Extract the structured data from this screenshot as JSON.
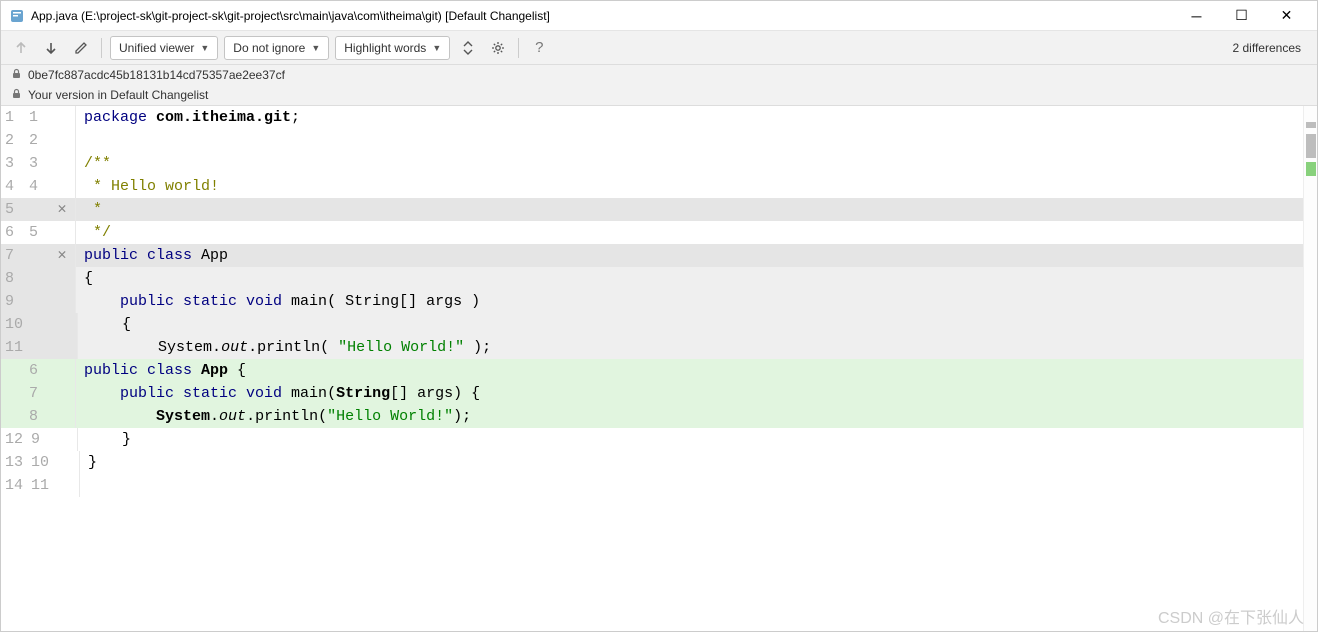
{
  "window": {
    "title": "App.java (E:\\project-sk\\git-project-sk\\git-project\\src\\main\\java\\com\\itheima\\git) [Default Changelist]"
  },
  "toolbar": {
    "viewer_label": "Unified viewer",
    "ignore_label": "Do not ignore",
    "highlight_label": "Highlight words",
    "diff_count": "2 differences"
  },
  "info": {
    "commit_hash": "0be7fc887acdc45b18131b14cd75357ae2ee37cf",
    "version_label": "Your version in Default Changelist"
  },
  "code": {
    "lines": [
      {
        "l": "1",
        "r": "1",
        "cls": "",
        "tokens": [
          {
            "t": "kw",
            "v": "package "
          },
          {
            "t": "pkg",
            "v": "com.itheima.git"
          },
          {
            "t": "",
            "v": ";"
          }
        ]
      },
      {
        "l": "2",
        "r": "2",
        "cls": "",
        "tokens": []
      },
      {
        "l": "3",
        "r": "3",
        "cls": "",
        "tokens": [
          {
            "t": "cmt",
            "v": "/**"
          }
        ]
      },
      {
        "l": "4",
        "r": "4",
        "cls": "",
        "tokens": [
          {
            "t": "cmt",
            "v": " * Hello world!"
          }
        ]
      },
      {
        "l": "5",
        "r": "",
        "cls": "del",
        "marker": "✕",
        "tokens": [
          {
            "t": "cmt",
            "v": " *"
          }
        ]
      },
      {
        "l": "6",
        "r": "5",
        "cls": "",
        "tokens": [
          {
            "t": "cmt",
            "v": " */"
          }
        ]
      },
      {
        "l": "7",
        "r": "",
        "cls": "del",
        "marker": "✕",
        "tokens": [
          {
            "t": "kw",
            "v": "public class "
          },
          {
            "t": "cls",
            "v": "App"
          },
          {
            "t": "",
            "v": " "
          }
        ]
      },
      {
        "l": "8",
        "r": "",
        "cls": "del-light",
        "tokens": [
          {
            "t": "",
            "v": "{"
          }
        ]
      },
      {
        "l": "9",
        "r": "",
        "cls": "del-light",
        "tokens": [
          {
            "t": "",
            "v": "    "
          },
          {
            "t": "kw",
            "v": "public static void "
          },
          {
            "t": "mth",
            "v": "main"
          },
          {
            "t": "",
            "v": "( "
          },
          {
            "t": "cls",
            "v": "String"
          },
          {
            "t": "",
            "v": "[] args )"
          }
        ]
      },
      {
        "l": "10",
        "r": "",
        "cls": "del-light",
        "tokens": [
          {
            "t": "",
            "v": "    {"
          }
        ]
      },
      {
        "l": "11",
        "r": "",
        "cls": "del-light",
        "tokens": [
          {
            "t": "",
            "v": "        "
          },
          {
            "t": "cls",
            "v": "System"
          },
          {
            "t": "",
            "v": "."
          },
          {
            "t": "fld",
            "v": "out"
          },
          {
            "t": "",
            "v": "."
          },
          {
            "t": "mth",
            "v": "println"
          },
          {
            "t": "",
            "v": "( "
          },
          {
            "t": "str",
            "v": "\"Hello World!\""
          },
          {
            "t": "",
            "v": " );"
          }
        ]
      },
      {
        "l": "",
        "r": "6",
        "cls": "add",
        "tokens": [
          {
            "t": "kw",
            "v": "public class "
          },
          {
            "t": "cls-b",
            "v": "App"
          },
          {
            "t": "",
            "v": " {"
          }
        ]
      },
      {
        "l": "",
        "r": "7",
        "cls": "add",
        "tokens": [
          {
            "t": "",
            "v": "    "
          },
          {
            "t": "kw",
            "v": "public static void "
          },
          {
            "t": "mth",
            "v": "main"
          },
          {
            "t": "",
            "v": "("
          },
          {
            "t": "cls-b",
            "v": "String"
          },
          {
            "t": "",
            "v": "[] args) {"
          }
        ]
      },
      {
        "l": "",
        "r": "8",
        "cls": "add",
        "tokens": [
          {
            "t": "",
            "v": "        "
          },
          {
            "t": "cls-b",
            "v": "System"
          },
          {
            "t": "",
            "v": "."
          },
          {
            "t": "fld",
            "v": "out"
          },
          {
            "t": "",
            "v": "."
          },
          {
            "t": "mth",
            "v": "println"
          },
          {
            "t": "",
            "v": "("
          },
          {
            "t": "str",
            "v": "\"Hello World!\""
          },
          {
            "t": "",
            "v": ");"
          }
        ]
      },
      {
        "l": "12",
        "r": "9",
        "cls": "",
        "tokens": [
          {
            "t": "",
            "v": "    }"
          }
        ]
      },
      {
        "l": "13",
        "r": "10",
        "cls": "",
        "tokens": [
          {
            "t": "",
            "v": "}"
          }
        ]
      },
      {
        "l": "14",
        "r": "11",
        "cls": "",
        "tokens": []
      }
    ]
  },
  "watermark": "CSDN @在下张仙人"
}
